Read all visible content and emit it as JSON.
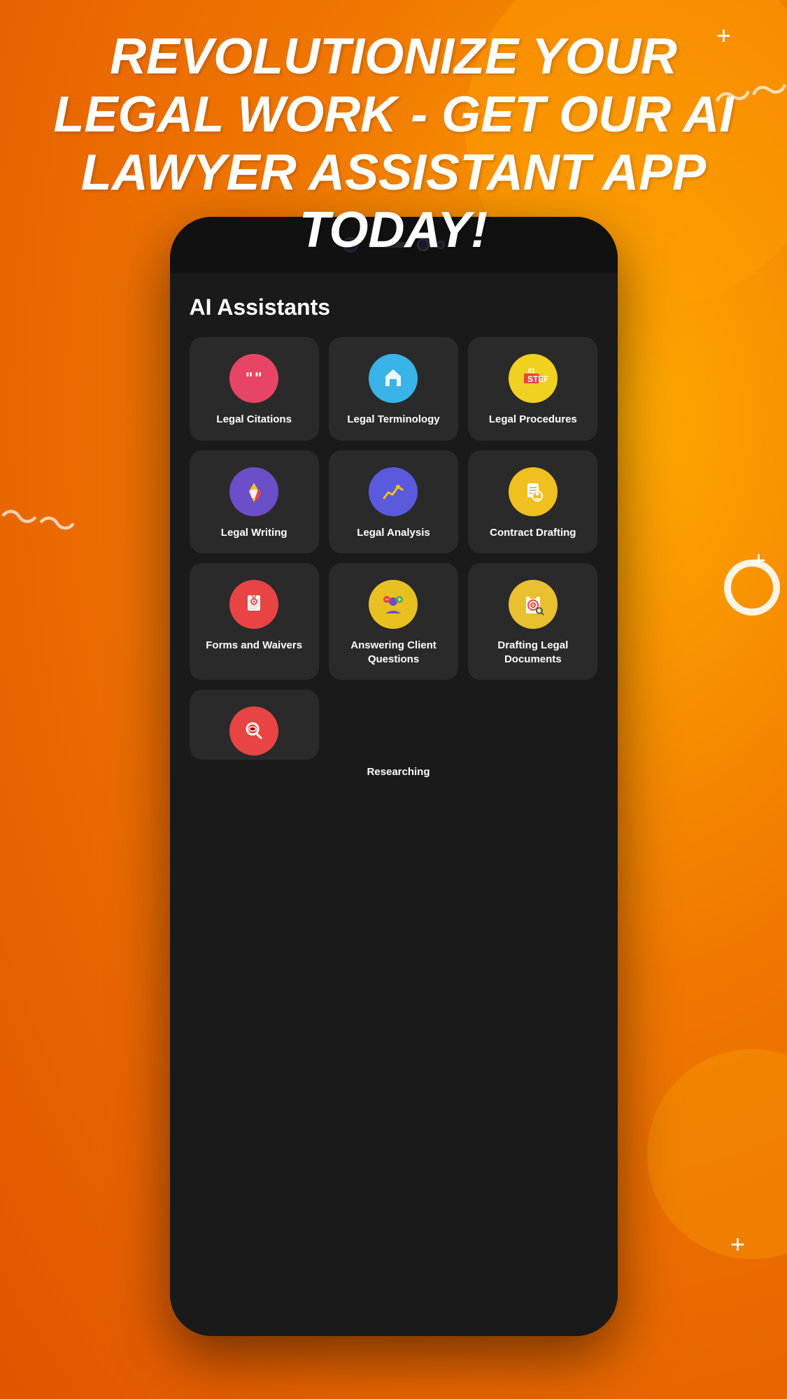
{
  "header": {
    "title": "REVOLUTIONIZE YOUR LEGAL WORK - GET OUR AI LAWYER ASSISTANT APP TODAY!"
  },
  "section": {
    "title": "AI Assistants"
  },
  "cards": [
    {
      "id": "legal-citations",
      "label": "Legal Citations",
      "icon_type": "citations",
      "icon_char": "❝"
    },
    {
      "id": "legal-terminology",
      "label": "Legal Terminology",
      "icon_type": "terminology",
      "icon_char": "🏠"
    },
    {
      "id": "legal-procedures",
      "label": "Legal Procedures",
      "icon_type": "procedures",
      "icon_char": "①"
    },
    {
      "id": "legal-writing",
      "label": "Legal Writing",
      "icon_type": "writing",
      "icon_char": "✒"
    },
    {
      "id": "legal-analysis",
      "label": "Legal Analysis",
      "icon_type": "analysis",
      "icon_char": "📈"
    },
    {
      "id": "contract-drafting",
      "label": "Contract Drafting",
      "icon_type": "drafting",
      "icon_char": "📄"
    },
    {
      "id": "forms-waivers",
      "label": "Forms and Waivers",
      "icon_type": "forms",
      "icon_char": "☢"
    },
    {
      "id": "answering-client",
      "label": "Answering Client Questions",
      "icon_type": "answering",
      "icon_char": "👤"
    },
    {
      "id": "drafting-legal",
      "label": "Drafting Legal Documents",
      "icon_type": "draftdocs",
      "icon_char": "📋"
    },
    {
      "id": "researching",
      "label": "Researching",
      "icon_type": "researching",
      "icon_char": "🔍"
    }
  ],
  "decorations": {
    "plus_signs": [
      "+",
      "+",
      "+"
    ],
    "squiggles": [
      "~",
      "~"
    ]
  }
}
